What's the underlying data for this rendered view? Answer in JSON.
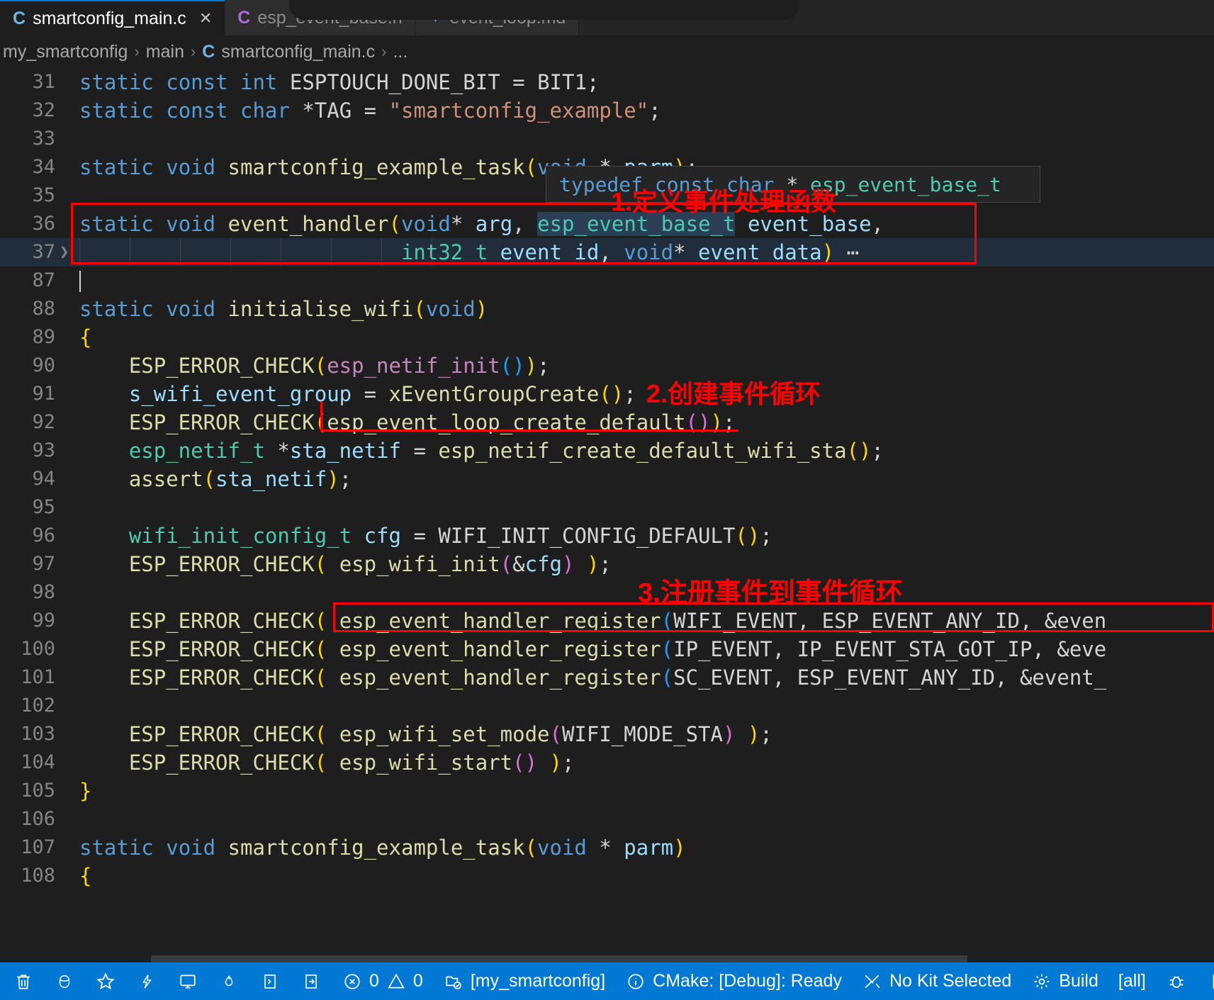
{
  "tabs": [
    {
      "label": "smartconfig_main.c",
      "icon": "c-file-icon",
      "icon_glyph": "C",
      "active": true,
      "closable": true
    },
    {
      "label": "esp_event_base.h",
      "icon": "h-file-icon",
      "icon_glyph": "C",
      "active": false,
      "closable": false
    },
    {
      "label": "event_loop.md",
      "icon": "markdown-file-icon",
      "icon_glyph": "▼",
      "active": false,
      "closable": false
    }
  ],
  "breadcrumb": {
    "items": [
      "my_smartconfig",
      "main",
      "smartconfig_main.c",
      "..."
    ],
    "file_icon_glyph": "C",
    "separator": "›"
  },
  "editor": {
    "lines": [
      {
        "n": "31",
        "text": "static const int ESPTOUCH_DONE_BIT = BIT1;"
      },
      {
        "n": "32",
        "text": "static const char *TAG = \"smartconfig_example\";"
      },
      {
        "n": "33",
        "text": ""
      },
      {
        "n": "34",
        "text": "static void smartconfig_example_task(void * parm);"
      },
      {
        "n": "35",
        "text": ""
      },
      {
        "n": "36",
        "text": "static void event_handler(void* arg, esp_event_base_t event_base,"
      },
      {
        "n": "37",
        "text": "                          int32_t event_id, void* event_data)⋯"
      },
      {
        "n": "87",
        "text": ""
      },
      {
        "n": "88",
        "text": "static void initialise_wifi(void)"
      },
      {
        "n": "89",
        "text": "{"
      },
      {
        "n": "90",
        "text": "    ESP_ERROR_CHECK(esp_netif_init());"
      },
      {
        "n": "91",
        "text": "    s_wifi_event_group = xEventGroupCreate();"
      },
      {
        "n": "92",
        "text": "    ESP_ERROR_CHECK(esp_event_loop_create_default());"
      },
      {
        "n": "93",
        "text": "    esp_netif_t *sta_netif = esp_netif_create_default_wifi_sta();"
      },
      {
        "n": "94",
        "text": "    assert(sta_netif);"
      },
      {
        "n": "95",
        "text": ""
      },
      {
        "n": "96",
        "text": "    wifi_init_config_t cfg = WIFI_INIT_CONFIG_DEFAULT();"
      },
      {
        "n": "97",
        "text": "    ESP_ERROR_CHECK( esp_wifi_init(&cfg) );"
      },
      {
        "n": "98",
        "text": ""
      },
      {
        "n": "99",
        "text": "    ESP_ERROR_CHECK( esp_event_handler_register(WIFI_EVENT, ESP_EVENT_ANY_ID, &even"
      },
      {
        "n": "100",
        "text": "    ESP_ERROR_CHECK( esp_event_handler_register(IP_EVENT, IP_EVENT_STA_GOT_IP, &eve"
      },
      {
        "n": "101",
        "text": "    ESP_ERROR_CHECK( esp_event_handler_register(SC_EVENT, ESP_EVENT_ANY_ID, &event_"
      },
      {
        "n": "102",
        "text": ""
      },
      {
        "n": "103",
        "text": "    ESP_ERROR_CHECK( esp_wifi_set_mode(WIFI_MODE_STA) );"
      },
      {
        "n": "104",
        "text": "    ESP_ERROR_CHECK( esp_wifi_start() );"
      },
      {
        "n": "105",
        "text": "}"
      },
      {
        "n": "106",
        "text": ""
      },
      {
        "n": "107",
        "text": "static void smartconfig_example_task(void * parm)"
      },
      {
        "n": "108",
        "text": "{"
      }
    ]
  },
  "hover_tooltip": {
    "text": "typedef const char * esp_event_base_t"
  },
  "annotations": [
    {
      "id": "anno-1",
      "text": "1.定义事件处理函数"
    },
    {
      "id": "anno-2",
      "text": "2.创建事件循环"
    },
    {
      "id": "anno-3",
      "text": "3.注册事件到事件循环"
    }
  ],
  "annotation_color": "#ff0000",
  "statusbar": {
    "items": [
      {
        "name": "remove-icon",
        "icon": "trash",
        "label": ""
      },
      {
        "name": "database-icon",
        "icon": "database",
        "label": ""
      },
      {
        "name": "favorite-icon",
        "icon": "star",
        "label": ""
      },
      {
        "name": "flash-icon",
        "icon": "flash",
        "label": ""
      },
      {
        "name": "monitor-icon",
        "icon": "monitor",
        "label": ""
      },
      {
        "name": "flame-icon",
        "icon": "flame",
        "label": ""
      },
      {
        "name": "terminal-icon",
        "icon": "terminal",
        "label": ""
      },
      {
        "name": "open-right-icon",
        "icon": "openright",
        "label": ""
      },
      {
        "name": "errors-warnings",
        "icon": "errwarn",
        "label": "0",
        "label2": "0"
      },
      {
        "name": "active-folder",
        "icon": "folder",
        "label": "[my_smartconfig]"
      },
      {
        "name": "cmake-status",
        "icon": "info",
        "label": "CMake: [Debug]: Ready"
      },
      {
        "name": "kit-selector",
        "icon": "tools",
        "label": "No Kit Selected"
      },
      {
        "name": "build-button",
        "icon": "gear",
        "label": "Build"
      },
      {
        "name": "build-target",
        "icon": "none",
        "label": "[all]"
      },
      {
        "name": "debug-button",
        "icon": "bug",
        "label": ""
      },
      {
        "name": "launch-button",
        "icon": "play",
        "label": ""
      }
    ],
    "error_count": "0",
    "warning_count": "0",
    "background_color": "#0078d4"
  }
}
